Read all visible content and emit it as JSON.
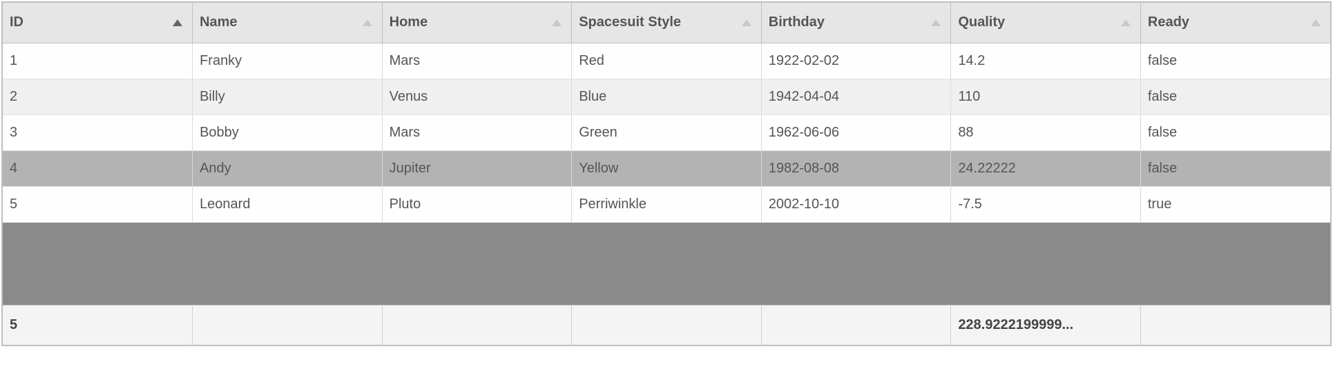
{
  "columns": [
    {
      "key": "id",
      "label": "ID",
      "sort": "active"
    },
    {
      "key": "name",
      "label": "Name",
      "sort": "idle"
    },
    {
      "key": "home",
      "label": "Home",
      "sort": "idle"
    },
    {
      "key": "spacesuit",
      "label": "Spacesuit Style",
      "sort": "idle"
    },
    {
      "key": "birthday",
      "label": "Birthday",
      "sort": "idle"
    },
    {
      "key": "quality",
      "label": "Quality",
      "sort": "idle"
    },
    {
      "key": "ready",
      "label": "Ready",
      "sort": "idle"
    }
  ],
  "rows": [
    {
      "id": "1",
      "name": "Franky",
      "home": "Mars",
      "spacesuit": "Red",
      "birthday": "1922-02-02",
      "quality": "14.2",
      "ready": "false",
      "selected": false
    },
    {
      "id": "2",
      "name": "Billy",
      "home": "Venus",
      "spacesuit": "Blue",
      "birthday": "1942-04-04",
      "quality": "110",
      "ready": "false",
      "selected": false
    },
    {
      "id": "3",
      "name": "Bobby",
      "home": "Mars",
      "spacesuit": "Green",
      "birthday": "1962-06-06",
      "quality": "88",
      "ready": "false",
      "selected": false
    },
    {
      "id": "4",
      "name": "Andy",
      "home": "Jupiter",
      "spacesuit": "Yellow",
      "birthday": "1982-08-08",
      "quality": "24.22222",
      "ready": "false",
      "selected": true
    },
    {
      "id": "5",
      "name": "Leonard",
      "home": "Pluto",
      "spacesuit": "Perriwinkle",
      "birthday": "2002-10-10",
      "quality": "-7.5",
      "ready": "true",
      "selected": false
    }
  ],
  "footer": {
    "id": "5",
    "name": "",
    "home": "",
    "spacesuit": "",
    "birthday": "",
    "quality": "228.9222199999...",
    "ready": ""
  },
  "colors": {
    "header_bg": "#e6e6e6",
    "row_odd_bg": "#fefefe",
    "row_even_bg": "#f0f0f0",
    "row_selected_bg": "#b3b3b3",
    "spacer_bg": "#8a8a8a",
    "sort_active": "#666666",
    "sort_idle": "#c9c9c9"
  }
}
